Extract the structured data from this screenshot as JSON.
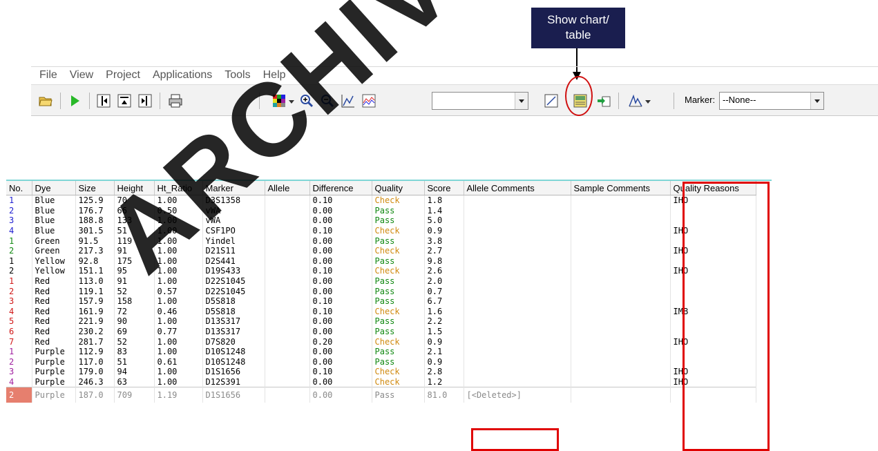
{
  "annotation": {
    "line1": "Show chart/",
    "line2": "table"
  },
  "menu": [
    "File",
    "View",
    "Project",
    "Applications",
    "Tools",
    "Help"
  ],
  "toolbar": {
    "marker_label": "Marker:",
    "marker_value": "--None--"
  },
  "table": {
    "headers": [
      "No.",
      "Dye",
      "Size",
      "Height",
      "Ht_Ratio",
      "Marker",
      "Allele",
      "Difference",
      "Quality",
      "Score",
      "Allele Comments",
      "Sample Comments",
      "Quality Reasons"
    ],
    "rows": [
      [
        "1",
        "Blue",
        "125.9",
        "70",
        "1.00",
        "D3S1358",
        "",
        "0.10",
        "Check",
        "1.8",
        "",
        "",
        "IHO"
      ],
      [
        "2",
        "Blue",
        "176.7",
        "66",
        "0.50",
        "vWA",
        "",
        "0.00",
        "Pass",
        "1.4",
        "",
        "",
        ""
      ],
      [
        "3",
        "Blue",
        "188.8",
        "133",
        "1.00",
        "vWA",
        "",
        "0.00",
        "Pass",
        "5.0",
        "",
        "",
        ""
      ],
      [
        "4",
        "Blue",
        "301.5",
        "51",
        "1.00",
        "CSF1PO",
        "",
        "0.10",
        "Check",
        "0.9",
        "",
        "",
        "IHO"
      ],
      [
        "1",
        "Green",
        "91.5",
        "119",
        "1.00",
        "Yindel",
        "",
        "0.00",
        "Pass",
        "3.8",
        "",
        "",
        ""
      ],
      [
        "2",
        "Green",
        "217.3",
        "91",
        "1.00",
        "D21S11",
        "",
        "0.00",
        "Check",
        "2.7",
        "",
        "",
        "IHO"
      ],
      [
        "1",
        "Yellow",
        "92.8",
        "175",
        "1.00",
        "D2S441",
        "",
        "0.00",
        "Pass",
        "9.8",
        "",
        "",
        ""
      ],
      [
        "2",
        "Yellow",
        "151.1",
        "95",
        "1.00",
        "D19S433",
        "",
        "0.10",
        "Check",
        "2.6",
        "",
        "",
        "IHO"
      ],
      [
        "1",
        "Red",
        "113.0",
        "91",
        "1.00",
        "D22S1045",
        "",
        "0.00",
        "Pass",
        "2.0",
        "",
        "",
        ""
      ],
      [
        "2",
        "Red",
        "119.1",
        "52",
        "0.57",
        "D22S1045",
        "",
        "0.00",
        "Pass",
        "0.7",
        "",
        "",
        ""
      ],
      [
        "3",
        "Red",
        "157.9",
        "158",
        "1.00",
        "D5S818",
        "",
        "0.10",
        "Pass",
        "6.7",
        "",
        "",
        ""
      ],
      [
        "4",
        "Red",
        "161.9",
        "72",
        "0.46",
        "D5S818",
        "",
        "0.10",
        "Check",
        "1.6",
        "",
        "",
        "IMB"
      ],
      [
        "5",
        "Red",
        "221.9",
        "90",
        "1.00",
        "D13S317",
        "",
        "0.00",
        "Pass",
        "2.2",
        "",
        "",
        ""
      ],
      [
        "6",
        "Red",
        "230.2",
        "69",
        "0.77",
        "D13S317",
        "",
        "0.00",
        "Pass",
        "1.5",
        "",
        "",
        ""
      ],
      [
        "7",
        "Red",
        "281.7",
        "52",
        "1.00",
        "D7S820",
        "",
        "0.20",
        "Check",
        "0.9",
        "",
        "",
        "IHO"
      ],
      [
        "1",
        "Purple",
        "112.9",
        "83",
        "1.00",
        "D10S1248",
        "",
        "0.00",
        "Pass",
        "2.1",
        "",
        "",
        ""
      ],
      [
        "2",
        "Purple",
        "117.0",
        "51",
        "0.61",
        "D10S1248",
        "",
        "0.00",
        "Pass",
        "0.9",
        "",
        "",
        ""
      ],
      [
        "3",
        "Purple",
        "179.0",
        "94",
        "1.00",
        "D1S1656",
        "",
        "0.10",
        "Check",
        "2.8",
        "",
        "",
        "IHO"
      ],
      [
        "4",
        "Purple",
        "246.3",
        "63",
        "1.00",
        "D12S391",
        "",
        "0.00",
        "Check",
        "1.2",
        "",
        "",
        "IHO"
      ]
    ],
    "deleted_row": [
      "2",
      "Purple",
      "187.0",
      "709",
      "1.19",
      "D1S1656",
      "",
      "0.00",
      "Pass",
      "81.0",
      "[<Deleted>]",
      "",
      ""
    ]
  },
  "watermark": "ARCHIVED",
  "colors": {
    "callout_bg": "#1a1e4f",
    "highlight_red": "#e00000",
    "pass_green": "#108810",
    "check_orange": "#d08a10"
  }
}
